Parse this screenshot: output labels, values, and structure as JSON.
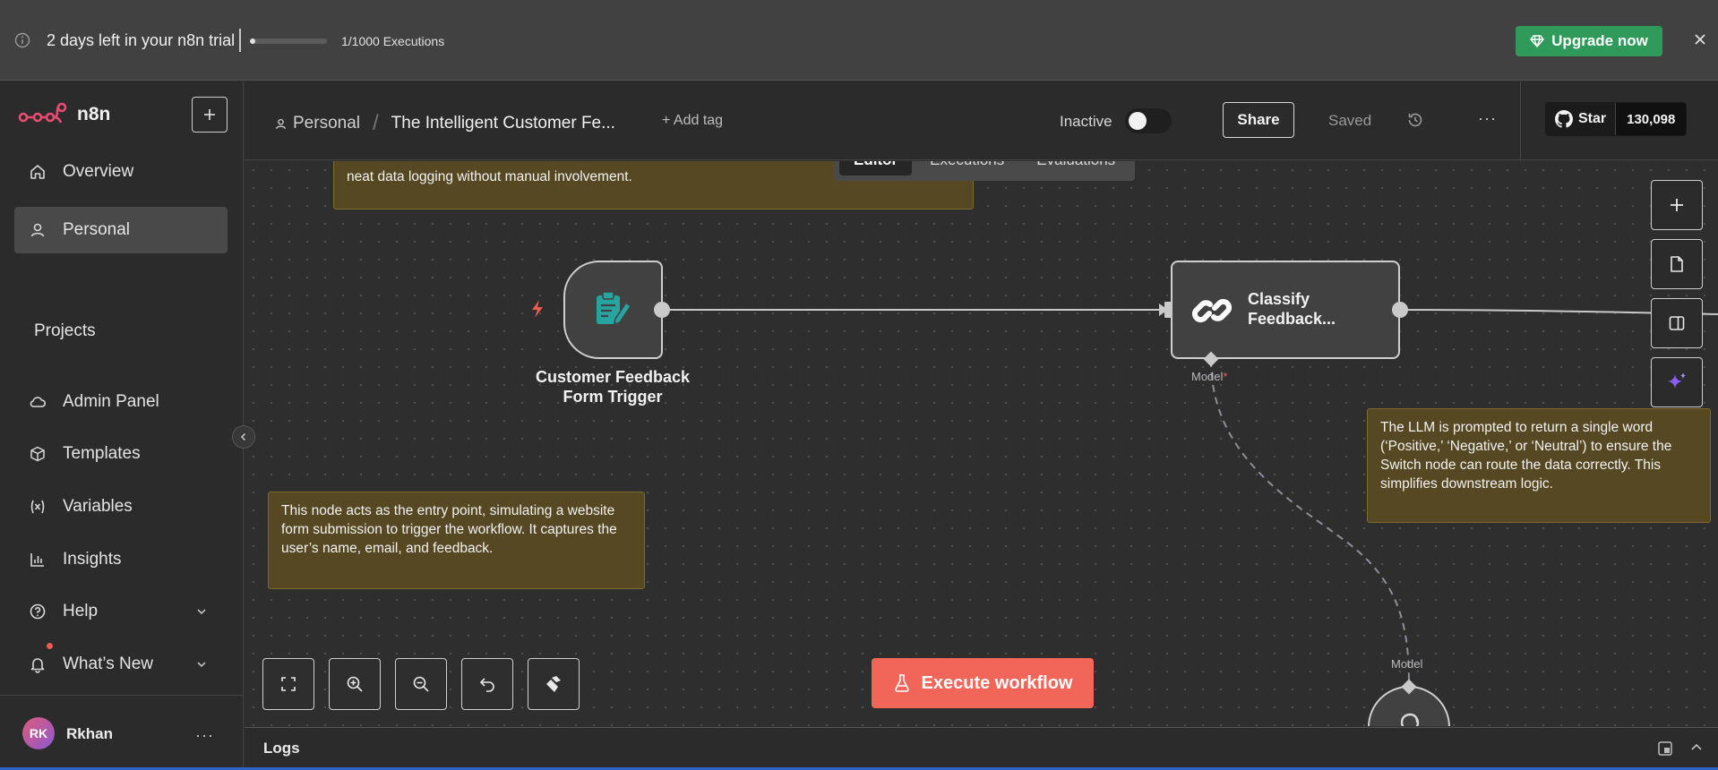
{
  "colors": {
    "accent_green": "#2f9a5a",
    "execute_red": "#f2665a",
    "sticky_bg": "#564822",
    "trigger_bolt": "#ee5a52",
    "node_teal": "#26a5a0",
    "ai_purple": "#8a5cf6"
  },
  "banner": {
    "trial_text": "2 days left in your n8n trial",
    "executions_text": "1/1000 Executions",
    "executions_progress": 0.001,
    "upgrade_label": "Upgrade now",
    "icons": [
      "info-icon",
      "diamond-icon",
      "close-icon"
    ]
  },
  "sidebar": {
    "logo_text": "n8n",
    "nav": [
      {
        "label": "Overview",
        "icon": "home-icon"
      },
      {
        "label": "Personal",
        "icon": "user-icon",
        "active": true
      }
    ],
    "projects_heading": "Projects",
    "items": [
      {
        "label": "Admin Panel",
        "icon": "cloud-icon"
      },
      {
        "label": "Templates",
        "icon": "box-icon"
      },
      {
        "label": "Variables",
        "icon": "variable-icon"
      },
      {
        "label": "Insights",
        "icon": "chart-icon"
      },
      {
        "label": "Help",
        "icon": "help-icon",
        "chevron": true
      },
      {
        "label": "What’s New",
        "icon": "bell-icon",
        "chevron": true
      }
    ],
    "user": {
      "initials": "RK",
      "name": "Rkhan",
      "more": "···"
    }
  },
  "header": {
    "breadcrumb_project": "Personal",
    "breadcrumb_separator": "/",
    "workflow_title": "The Intelligent Customer Fe...",
    "add_tag": "+ Add tag",
    "status_label": "Inactive",
    "active": false,
    "share_label": "Share",
    "saved_label": "Saved",
    "more": "···",
    "github": {
      "star_label": "Star",
      "count": "130,098"
    }
  },
  "tabs": [
    {
      "label": "Editor",
      "active": true
    },
    {
      "label": "Executions",
      "active": false
    },
    {
      "label": "Evaluations",
      "active": false
    }
  ],
  "canvas": {
    "stickies": {
      "top": "neat data logging without manual involvement.",
      "trigger_note": "This node acts as the entry point, simulating a website form submission to trigger the workflow. It captures the user’s name, email, and feedback.",
      "llm_note": "The LLM is prompted to return a single word (‘Positive,’ ‘Negative,’ or ‘Neutral’) to ensure the Switch node can route the data correctly. This simplifies downstream logic."
    },
    "nodes": {
      "trigger": {
        "label_line1": "Customer Feedback",
        "label_line2": "Form Trigger",
        "icon": "form-icon"
      },
      "classify": {
        "label_line1": "Classify",
        "label_line2": "Feedback...",
        "icon": "link-icon"
      },
      "model": {
        "icon": "openai-icon"
      }
    },
    "ports": {
      "model_in": "Model",
      "model_required": "*",
      "model_out": "Model"
    },
    "execute_label": "Execute workflow",
    "right_tools": [
      "plus-icon",
      "sticky-note-icon",
      "panel-icon",
      "ai-sparkle-icon"
    ],
    "bottom_tools": [
      "fit-view-icon",
      "zoom-in-icon",
      "zoom-out-icon",
      "undo-icon",
      "clear-icon"
    ]
  },
  "logs": {
    "label": "Logs"
  }
}
